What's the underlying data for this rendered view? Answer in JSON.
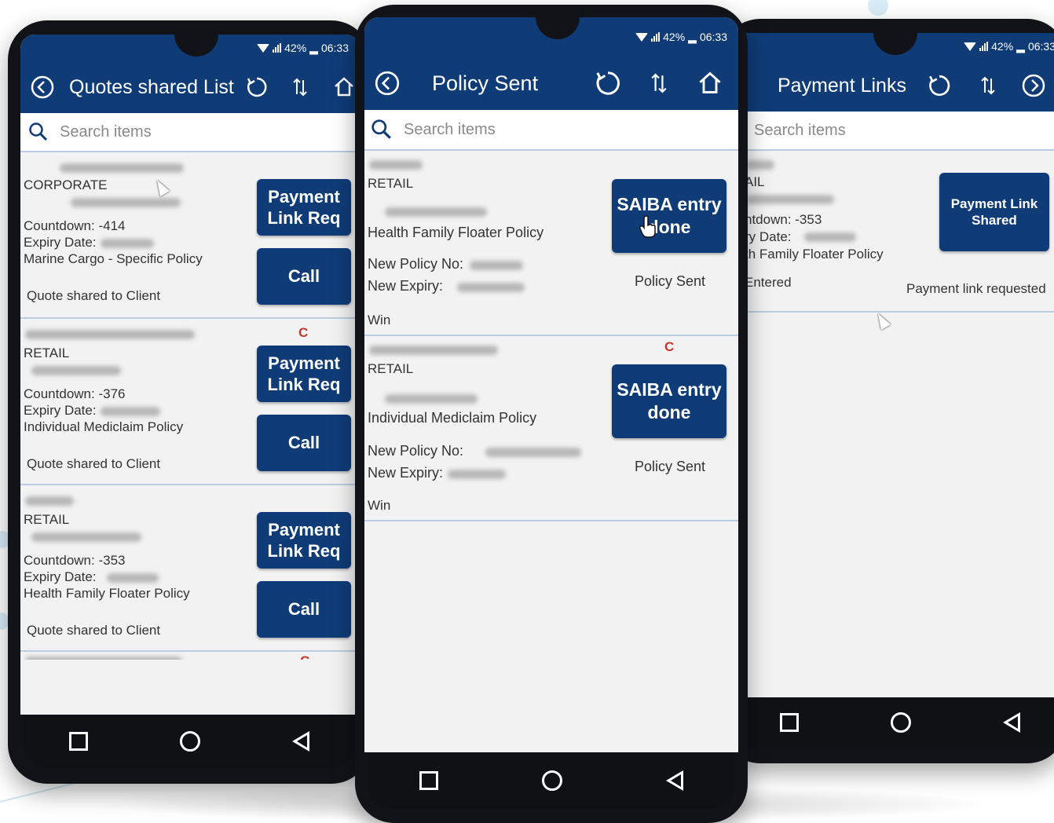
{
  "colors": {
    "brand": "#0f3c77",
    "accent_red": "#c0392b",
    "divider": "#b9cde2"
  },
  "status": {
    "battery": "42%",
    "time": "06:33"
  },
  "search_placeholder": "Search items",
  "phones": {
    "quotes": {
      "title": "Quotes shared List",
      "items": [
        {
          "type": "CORPORATE",
          "countdown": "Countdown: -414",
          "expiry_label": "Expiry Date:",
          "policy": "Marine Cargo - Specific Policy",
          "status": "Quote shared to Client",
          "btn_pay_line1": "Payment",
          "btn_pay_line2": "Link Req",
          "btn_call": "Call",
          "flag": ""
        },
        {
          "type": "RETAIL",
          "countdown": "Countdown: -376",
          "expiry_label": "Expiry Date:",
          "policy": "Individual Mediclaim Policy",
          "status": "Quote shared to Client",
          "btn_pay_line1": "Payment",
          "btn_pay_line2": "Link Req",
          "btn_call": "Call",
          "flag": "C"
        },
        {
          "type": "RETAIL",
          "countdown": "Countdown: -353",
          "expiry_label": "Expiry Date:",
          "policy": "Health Family Floater Policy",
          "status": "Quote shared to Client",
          "btn_pay_line1": "Payment",
          "btn_pay_line2": "Link Req",
          "btn_call": "Call",
          "flag": ""
        }
      ],
      "partial_flag": "C"
    },
    "policy": {
      "title": "Policy Sent",
      "items": [
        {
          "type": "RETAIL",
          "policy": "Health Family Floater Policy",
          "new_policy_label": "New Policy No:",
          "new_expiry_label": "New Expiry:",
          "result": "Win",
          "btn_line1": "SAIBA entry",
          "btn_line2": "done",
          "status": "Policy Sent",
          "flag": ""
        },
        {
          "type": "RETAIL",
          "policy": "Individual Mediclaim Policy",
          "new_policy_label": "New Policy No:",
          "new_expiry_label": "New Expiry:",
          "result": "Win",
          "btn_line1": "SAIBA entry",
          "btn_line2": "done",
          "status": "Policy Sent",
          "flag": "C"
        }
      ]
    },
    "payment": {
      "title": "Payment Links",
      "item": {
        "type": "AIL",
        "countdown": "ntdown: -353",
        "expiry_label": "ry Date:",
        "policy": "th Family Floater Policy",
        "status": "Entered",
        "btn_line1": "Payment Link",
        "btn_line2": "Shared",
        "btn_caption": "Payment link requested"
      }
    }
  },
  "icons": [
    "back-icon",
    "refresh-icon",
    "sort-icon",
    "home-icon",
    "search-icon",
    "forward-icon",
    "wifi-icon",
    "signal-icon",
    "battery-icon",
    "nav-recent-icon",
    "nav-home-icon",
    "nav-back-icon",
    "mouse-cursor-icon"
  ]
}
